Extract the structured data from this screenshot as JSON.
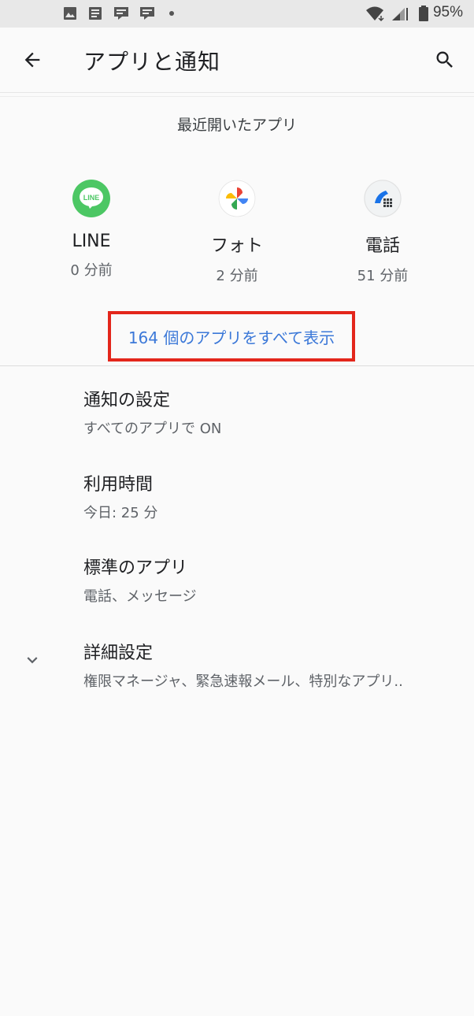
{
  "status_bar": {
    "battery_text": "95%",
    "icons": [
      "image-icon",
      "news-icon",
      "line-manga-icon",
      "line-manga-icon",
      "dot-icon",
      "wifi-icon",
      "signal-icon",
      "battery-icon"
    ]
  },
  "appbar": {
    "title": "アプリと通知",
    "back_icon": "back-arrow-icon",
    "search_icon": "search-icon"
  },
  "recent": {
    "title": "最近開いたアプリ",
    "apps": [
      {
        "name": "LINE",
        "time": "0 分前",
        "icon": "line-app-icon",
        "color": "#4cc764"
      },
      {
        "name": "フォト",
        "time": "2 分前",
        "icon": "photos-app-icon",
        "color": "#ffffff"
      },
      {
        "name": "電話",
        "time": "51 分前",
        "icon": "phone-app-icon",
        "color": "#1a73e8"
      }
    ],
    "see_all": "164 個のアプリをすべて表示"
  },
  "settings": [
    {
      "title": "通知の設定",
      "subtitle": "すべてのアプリで ON"
    },
    {
      "title": "利用時間",
      "subtitle": "今日: 25 分"
    },
    {
      "title": "標準のアプリ",
      "subtitle": "電話、メッセージ"
    },
    {
      "title": "詳細設定",
      "subtitle": "権限マネージャ、緊急速報メール、特別なアプリ.."
    }
  ],
  "colors": {
    "accent": "#3b78d8",
    "highlight_border": "#e3261b"
  }
}
